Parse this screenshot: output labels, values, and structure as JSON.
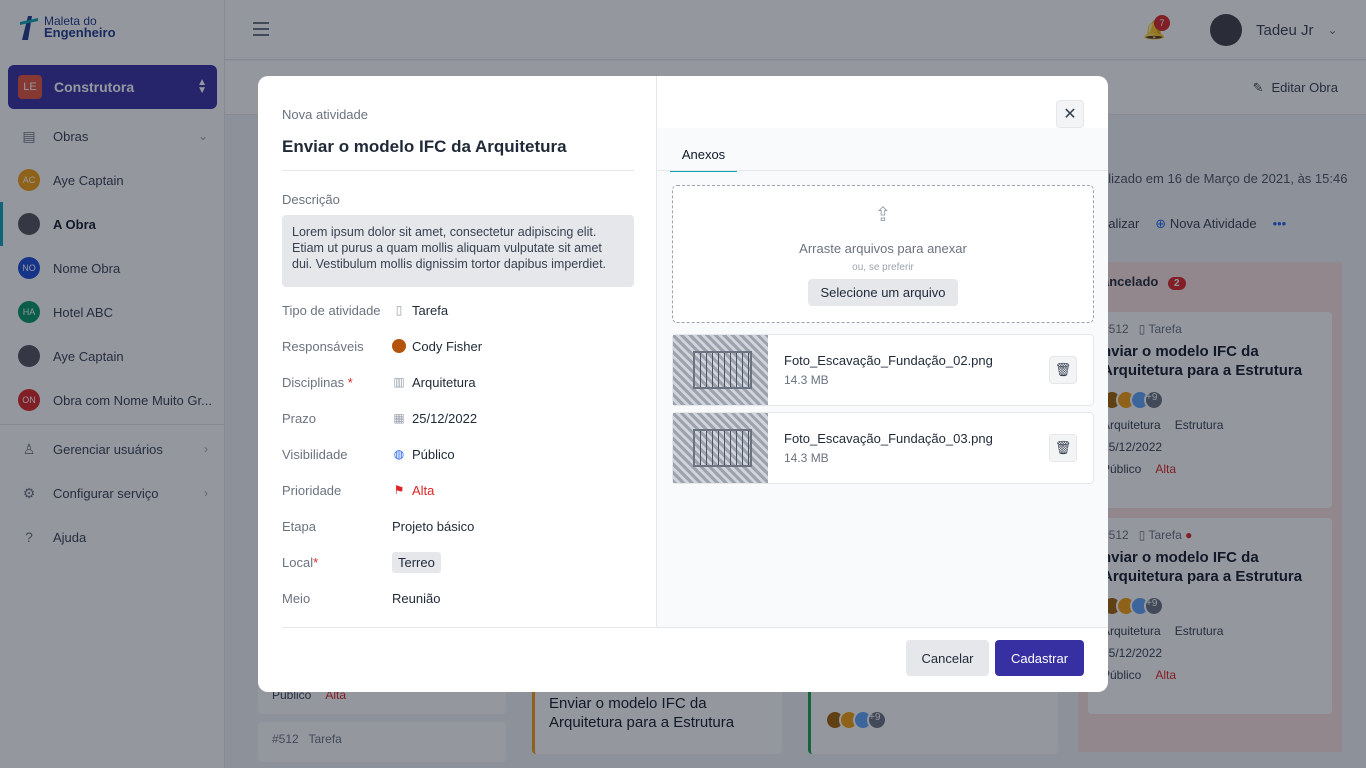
{
  "app": {
    "logo_line1": "Maleta do",
    "logo_line2": "Engenheiro"
  },
  "sidebar": {
    "org": {
      "badge": "LE",
      "name": "Construtora"
    },
    "items": [
      {
        "label": "Obras",
        "icon": "building-icon",
        "type": "section"
      },
      {
        "label": "Aye Captain",
        "initials": "AC",
        "color": "#f59e0b",
        "type": "avatar"
      },
      {
        "label": "A Obra",
        "initials": "",
        "color": "#52525b",
        "type": "avatar",
        "active": true
      },
      {
        "label": "Nome Obra",
        "initials": "NO",
        "color": "#1d4ed8",
        "type": "avatar"
      },
      {
        "label": "Hotel ABC",
        "initials": "HA",
        "color": "#059669",
        "type": "avatar"
      },
      {
        "label": "Aye Captain",
        "initials": "",
        "color": "#52525b",
        "type": "avatar"
      },
      {
        "label": "Obra com Nome Muito Gr...",
        "initials": "ON",
        "color": "#dc2626",
        "type": "avatar"
      },
      {
        "label": "Gerenciar usuários",
        "icon": "user-icon",
        "type": "link"
      },
      {
        "label": "Configurar serviço",
        "icon": "gear-icon",
        "type": "link"
      },
      {
        "label": "Ajuda",
        "icon": "help-icon",
        "type": "link"
      }
    ]
  },
  "topbar": {
    "notification_count": "7",
    "user_name": "Tadeu Jr"
  },
  "subbar": {
    "edit_label": "Editar Obra"
  },
  "background": {
    "updated_text": "alizado em 16 de Março de 2021, às 15:46",
    "action_refresh": "ualizar",
    "action_new": "Nova Atividade",
    "column_title": "ancelado",
    "column_count": "2",
    "card_meta": "#512",
    "card_type": "Tarefa",
    "card_title": "nviar o modelo IFC da Arquitetura para a Estrutura",
    "card_disc1": "Arquitetura",
    "card_disc2": "Estrutura",
    "card_date": "25/12/2022",
    "card_vis": "Público",
    "card_prio": "Alta",
    "card_more": "+9",
    "bottom_card_title": "Enviar o modelo IFC da Arquitetura para a Estrutura",
    "bottom_vis": "Público",
    "bottom_prio": "Alta",
    "bottom_meta": "#512",
    "bottom_type": "Tarefa"
  },
  "modal": {
    "subtitle": "Nova atividade",
    "title": "Enviar o modelo IFC da Arquitetura",
    "description_label": "Descrição",
    "description": "Lorem ipsum dolor sit amet, consectetur adipiscing elit. Etiam ut purus a quam mollis aliquam vulputate sit amet dui. Vestibulum mollis dignissim tortor dapibus imperdiet.",
    "fields": {
      "tipo": {
        "label": "Tipo de atividade",
        "value": "Tarefa"
      },
      "responsaveis": {
        "label": "Responsáveis",
        "value": "Cody Fisher"
      },
      "disciplinas": {
        "label": "Disciplinas",
        "value": "Arquitetura"
      },
      "prazo": {
        "label": "Prazo",
        "value": "25/12/2022"
      },
      "visibilidade": {
        "label": "Visibilidade",
        "value": "Público"
      },
      "prioridade": {
        "label": "Prioridade",
        "value": "Alta"
      },
      "etapa": {
        "label": "Etapa",
        "value": "Projeto básico"
      },
      "local": {
        "label": "Local",
        "value": "Terreo"
      },
      "meio": {
        "label": "Meio",
        "value": "Reunião"
      }
    },
    "required_mark": "*",
    "tab": "Anexos",
    "dropzone": {
      "text": "Arraste arquivos para anexar",
      "or": "ou, se preferir",
      "button": "Selecione um arquivo"
    },
    "files": [
      {
        "name": "Foto_Escavação_Fundação_02.png",
        "size": "14.3 MB"
      },
      {
        "name": "Foto_Escavação_Fundação_03.png",
        "size": "14.3 MB"
      }
    ],
    "cancel_label": "Cancelar",
    "submit_label": "Cadastrar"
  }
}
